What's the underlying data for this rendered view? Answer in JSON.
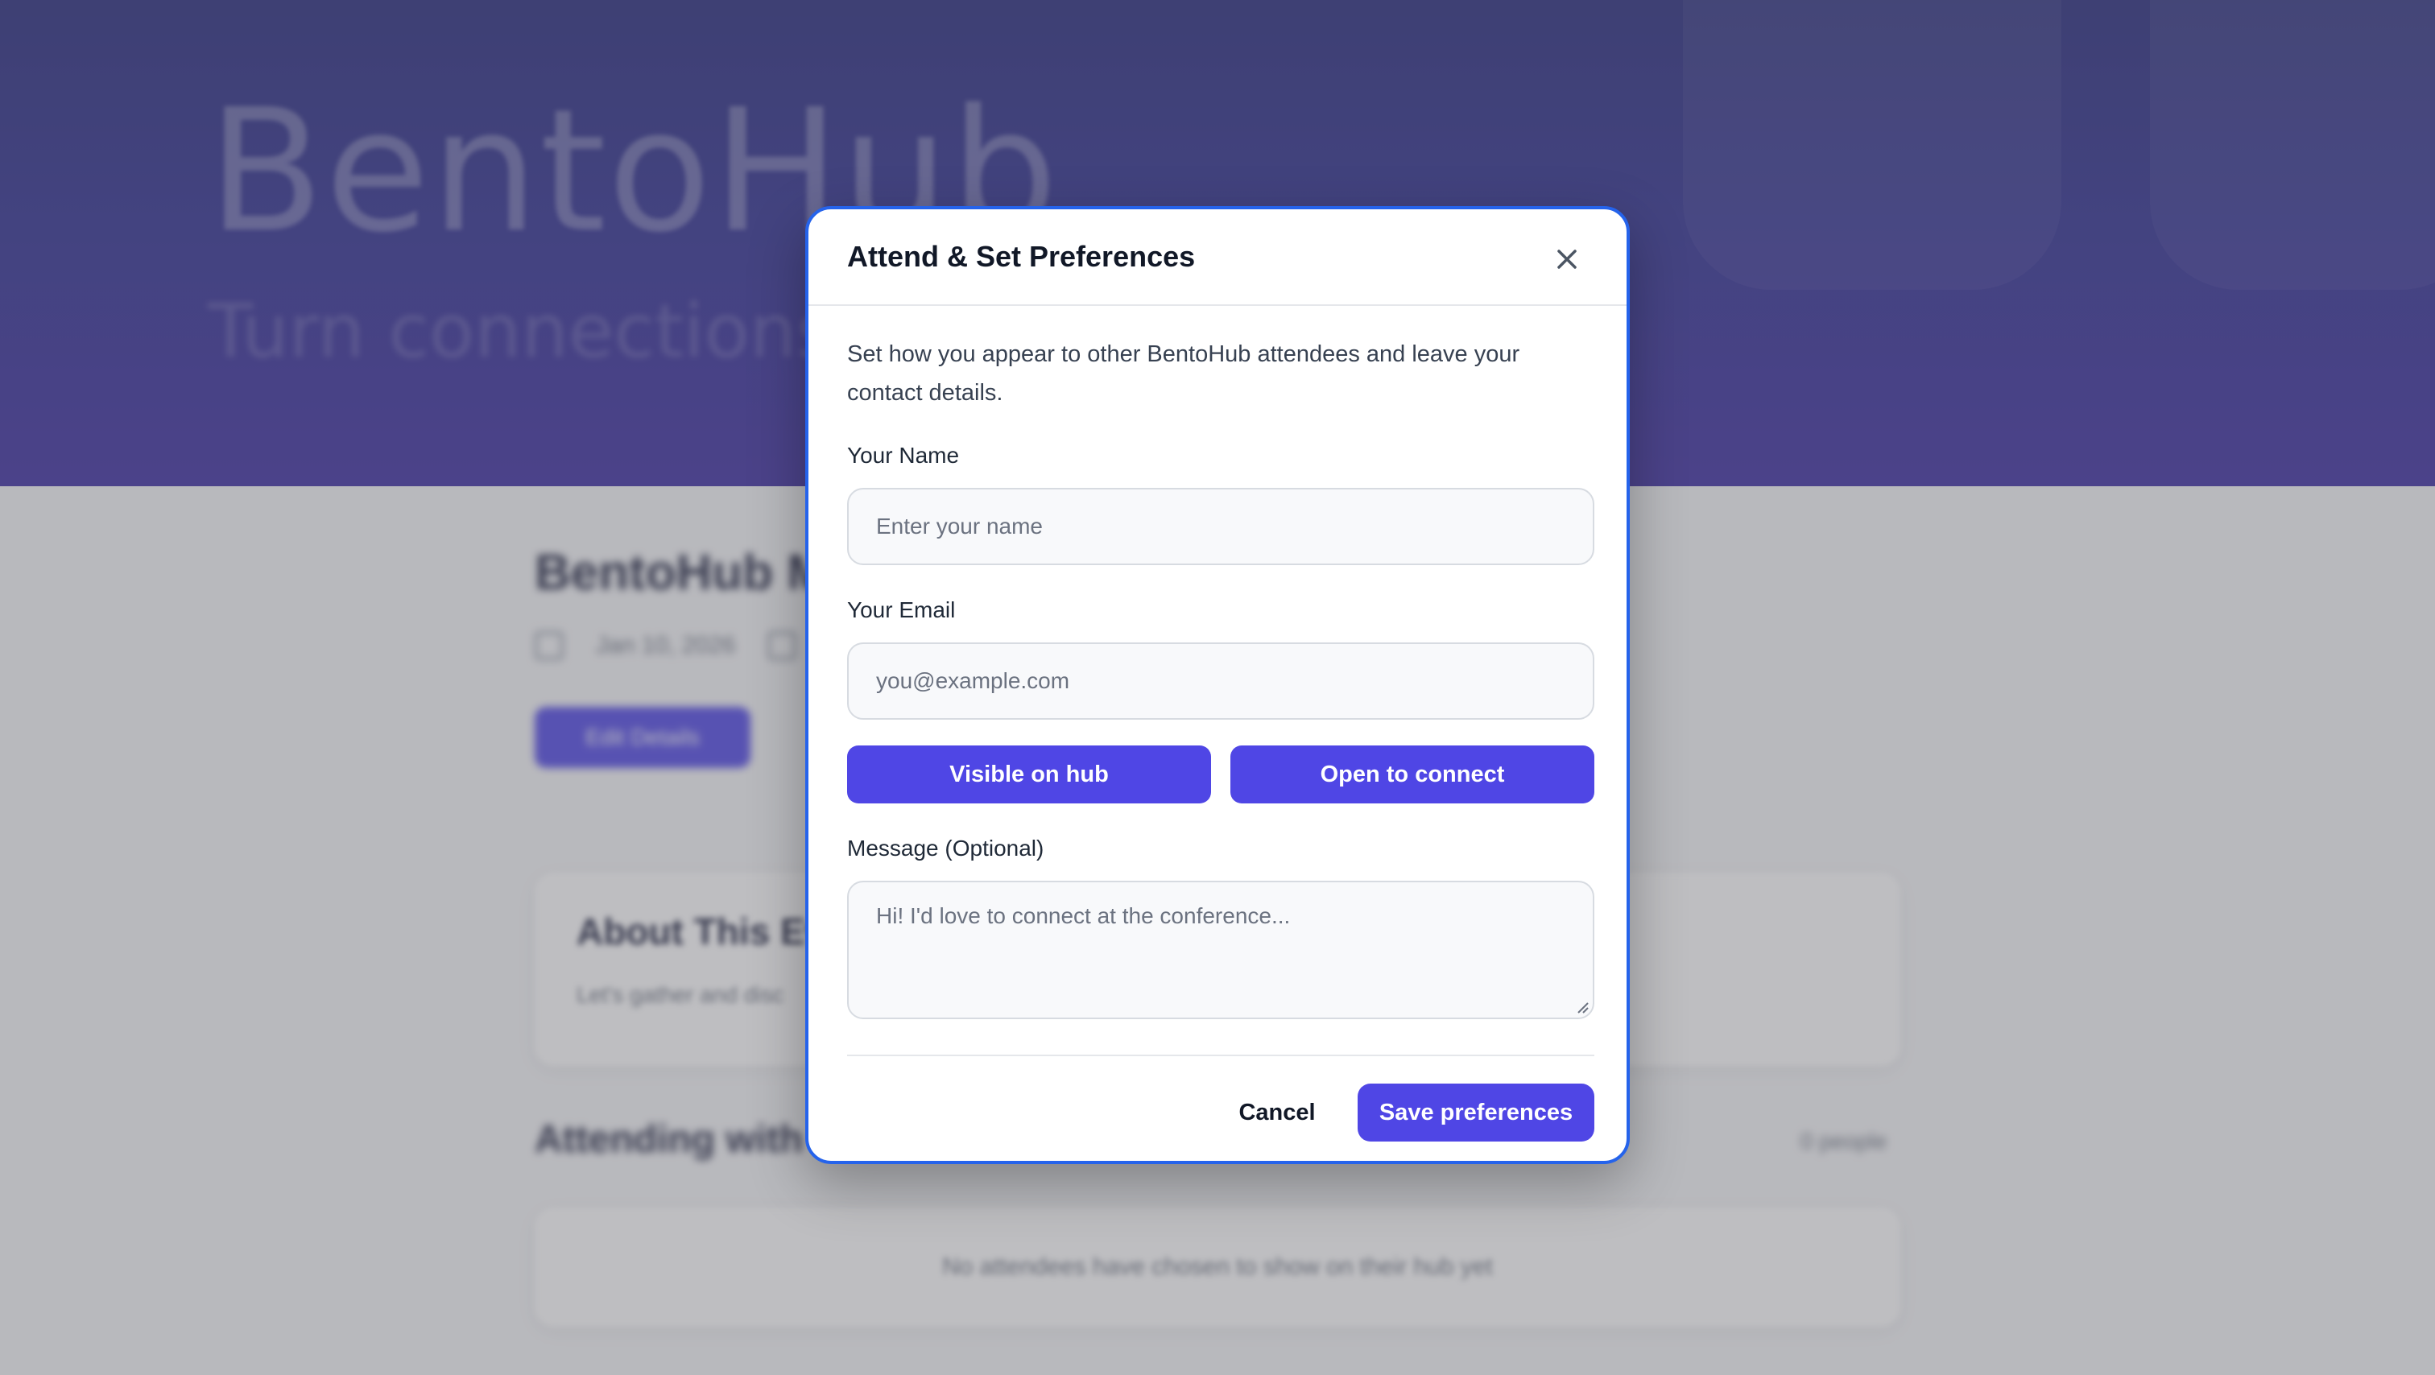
{
  "background": {
    "hero_title": "BentoHub",
    "hero_tagline": "Turn connections",
    "event_title": "BentoHub M",
    "event_date": "Jan 10, 2026",
    "event_cta_label": "Edit Details",
    "about_title": "About This Ev",
    "about_text": "Let's gather and disc",
    "attending_title": "Attending with",
    "attending_count": "0 people",
    "empty_message": "No attendees have chosen to show on their hub yet"
  },
  "modal": {
    "title": "Attend & Set Preferences",
    "close_icon": "close-icon",
    "description": "Set how you appear to other BentoHub attendees and leave your contact details.",
    "name": {
      "label": "Your Name",
      "placeholder": "Enter your name",
      "value": ""
    },
    "email": {
      "label": "Your Email",
      "placeholder": "you@example.com",
      "value": ""
    },
    "preferences": [
      {
        "label": "Visible on hub"
      },
      {
        "label": "Open to connect"
      }
    ],
    "message": {
      "label": "Message (Optional)",
      "placeholder": "Hi! I'd love to connect at the conference...",
      "value": ""
    },
    "cancel_label": "Cancel",
    "save_label": "Save preferences"
  },
  "colors": {
    "accent": "#4f46e5",
    "focus_ring": "#2563eb",
    "hero": "#2b2b8f"
  }
}
